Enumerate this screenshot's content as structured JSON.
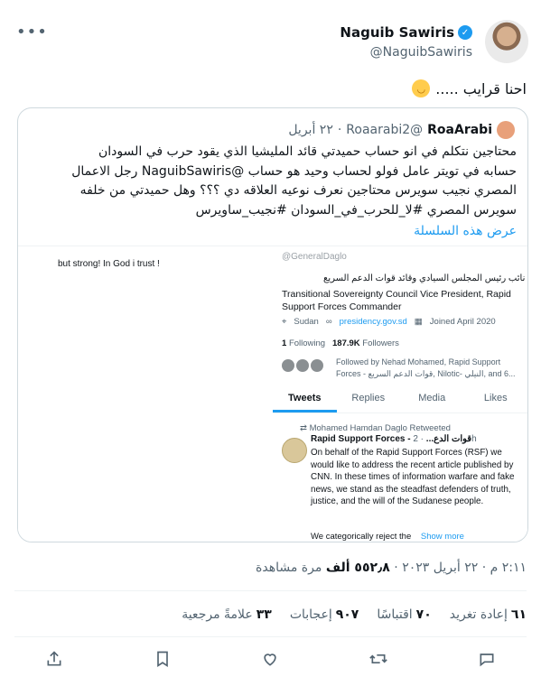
{
  "author": {
    "name": "Naguib Sawiris",
    "handle": "@NaguibSawiris",
    "icons": {
      "avatar": "avatar-photo",
      "verified": "verified-badge-icon",
      "more": "more-icon"
    }
  },
  "tweet": {
    "text": "احنا قرايب .....",
    "emoji": "smiling-face-emoji"
  },
  "quote": {
    "name": "RoaArabi",
    "handle": "@Roaarabi2",
    "date": "٢٢ أبريل",
    "lines": [
      "محتاجين نتكلم في انو حساب حميدتي قائد المليشيا الذي يقود حرب في السودان",
      "حسابه في تويتر عامل فولو لحساب وحيد هو حساب @NaguibSawiris  رجل الاعمال",
      "المصري نجيب سويرس محتاجين نعرف نوعيه العلاقه دي ؟؟؟  وهل حميدتي من خلفه",
      "سويرس المصري #لا_للحرب_في_السودان  #نجيب_ساويرس"
    ],
    "show_thread": "عرض هذه السلسلة",
    "image": {
      "left_text": "but strong! In God i trust !",
      "handle": "@GeneralDaglo",
      "bio_ar": "نائب رئيس المجلس السيادي وقائد قوات الدعم السريع",
      "bio_en": "Transitional Sovereignty Council Vice President, Rapid Support Forces Commander",
      "location": "Sudan",
      "link": "presidency.gov.sd",
      "joined": "Joined April 2020",
      "following_count": "1",
      "following_label": "Following",
      "followers_count": "187.9K",
      "followers_label": "Followers",
      "followed_by": "Followed by Nehad Mohamed, Rapid Support Forces - قوات الدعم السريع, Nilotic- النيلي, and 6...",
      "tabs": [
        "Tweets",
        "Replies",
        "Media",
        "Likes"
      ],
      "retweeted_by": "Mohamed Hamdan Daglo Retweeted",
      "rsf_name": "Rapid Support Forces - قوات الدع...",
      "rsf_time": "· 2h",
      "rsf_text": "On behalf of the Rapid Support Forces (RSF) we would like to address the recent article published by CNN. In these times of information warfare and fake news, we stand as the steadfast defenders of truth, justice, and the will of the Sudanese people.",
      "cut_text": "We categorically reject the",
      "show_more": "Show more"
    }
  },
  "timeline": {
    "time_date": "٢:١١ م · ٢٢ أبريل ٢٠٢٣ · ",
    "views_count": "٥٥٢٫٨ ألف",
    "views_label": " مرة مشاهدة"
  },
  "stats": [
    {
      "count": "٦١",
      "label": "إعادة تغريد"
    },
    {
      "count": "٧٠",
      "label": "اقتباسًا"
    },
    {
      "count": "٩٠٧",
      "label": "إعجابات"
    },
    {
      "count": "٣٣",
      "label": "علامةً مرجعية"
    }
  ],
  "actions": {
    "icons": [
      "share-icon",
      "bookmark-icon",
      "like-icon",
      "retweet-icon",
      "reply-icon"
    ]
  },
  "colors": {
    "accent": "#1d9bf0",
    "text": "#0f1419",
    "muted": "#536471",
    "border": "#cfd9de"
  }
}
